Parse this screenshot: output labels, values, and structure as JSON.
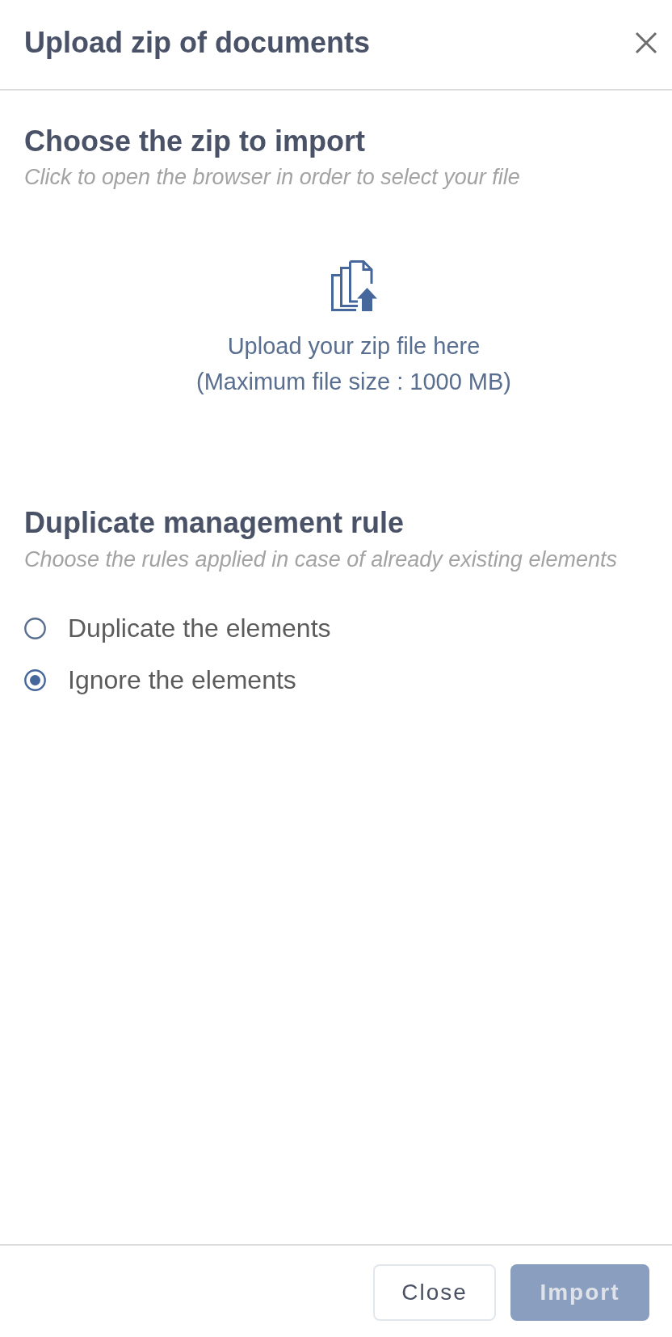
{
  "dialog": {
    "title": "Upload zip of documents"
  },
  "upload_section": {
    "heading": "Choose the zip to import",
    "hint": "Click to open the browser in order to select your file",
    "dropzone": {
      "label": "Upload your zip file here",
      "size_limit": "(Maximum file size : 1000 MB)"
    }
  },
  "duplicate_section": {
    "heading": "Duplicate management rule",
    "hint": "Choose the rules applied in case of already existing elements",
    "options": [
      {
        "label": "Duplicate the elements",
        "selected": false
      },
      {
        "label": "Ignore the elements",
        "selected": true
      }
    ]
  },
  "buttons": [
    {
      "label": "Close",
      "kind": "secondary",
      "disabled": false
    },
    {
      "label": "Import",
      "kind": "primary",
      "disabled": true
    }
  ]
}
